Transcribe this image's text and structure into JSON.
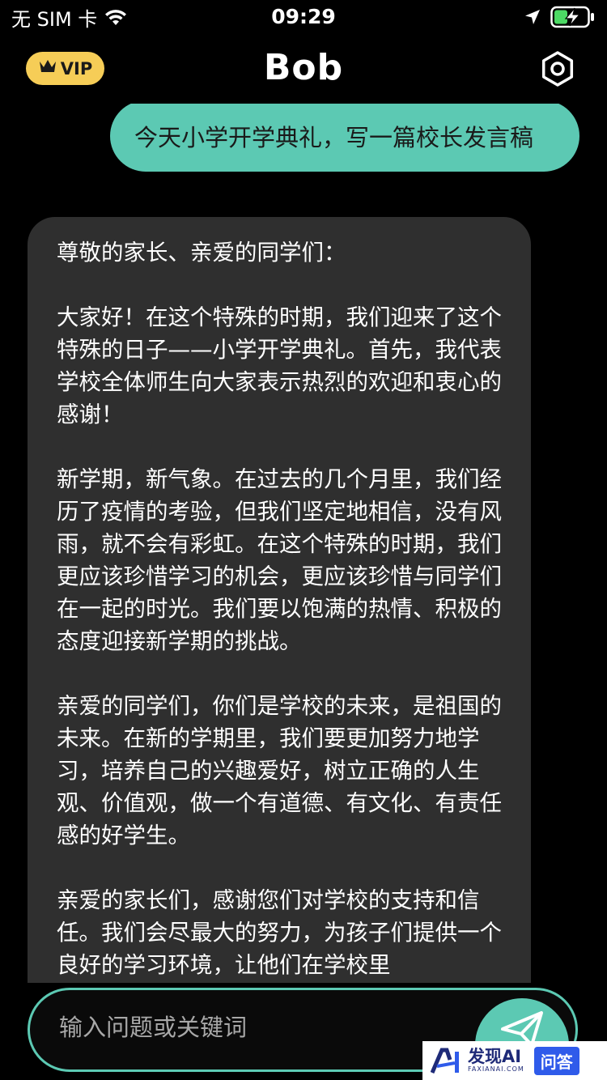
{
  "status_bar": {
    "carrier": "无 SIM 卡",
    "time": "09:29",
    "icons": [
      "wifi-icon",
      "location-arrow-icon",
      "battery-charging-icon"
    ]
  },
  "header": {
    "vip_label": "VIP",
    "title": "Bob",
    "icons": [
      "crown-icon",
      "settings-icon"
    ]
  },
  "chat": {
    "user_message": "今天小学开学典礼，写一篇校长发言稿",
    "bot_paragraphs": [
      "尊敬的家长、亲爱的同学们：",
      "大家好！在这个特殊的时期，我们迎来了这个特殊的日子——小学开学典礼。首先，我代表学校全体师生向大家表示热烈的欢迎和衷心的感谢！",
      "新学期，新气象。在过去的几个月里，我们经历了疫情的考验，但我们坚定地相信，没有风雨，就不会有彩虹。在这个特殊的时期，我们更应该珍惜学习的机会，更应该珍惜与同学们在一起的时光。我们要以饱满的热情、积极的态度迎接新学期的挑战。",
      "亲爱的同学们，你们是学校的未来，是祖国的未来。在新的学期里，我们要更加努力地学习，培养自己的兴趣爱好，树立正确的人生观、价值观，做一个有道德、有文化、有责任感的好学生。",
      "亲爱的家长们，感谢您们对学校的支持和信任。我们会尽最大的努力，为孩子们提供一个良好的学习环境，让他们在学校里"
    ]
  },
  "input": {
    "placeholder": "输入问题或关键词",
    "send_icon": "paper-plane-icon"
  },
  "watermark": {
    "name": "发现AI",
    "domain": "FAXIANAI.COM",
    "qa": "问答"
  },
  "colors": {
    "accent": "#5CC9B3",
    "vip": "#F6CD57",
    "bubble": "#2F2F2F",
    "background": "#000000"
  }
}
